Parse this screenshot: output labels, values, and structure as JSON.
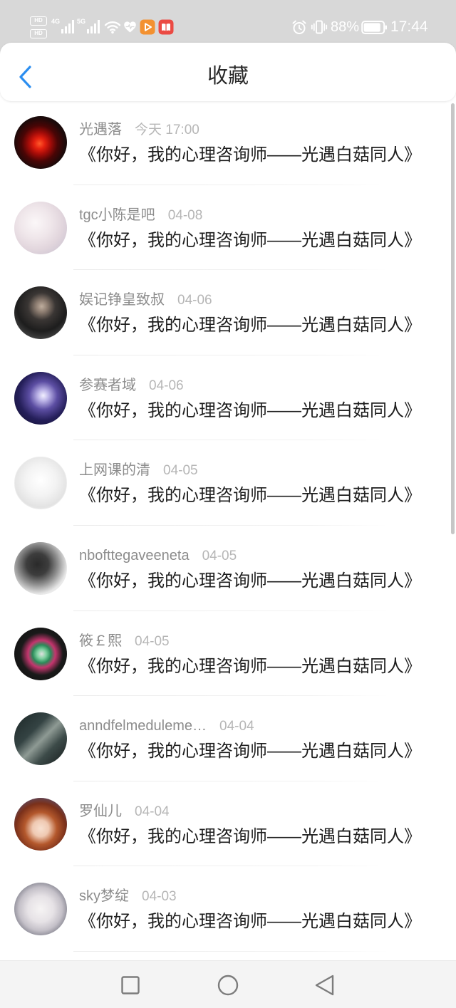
{
  "theme": {
    "accent": "#2b8ef0"
  },
  "status_bar": {
    "hd_label": "HD",
    "network_1": "4G",
    "network_2": "5G",
    "icons_left": [
      "hd-voice-badge",
      "signal-4g-icon",
      "signal-5g-icon",
      "wifi-icon",
      "heart-icon",
      "video-app-icon",
      "reader-app-icon"
    ],
    "icons_right": [
      "alarm-icon",
      "vibrate-icon",
      "battery-icon"
    ],
    "battery": {
      "level": 0.88,
      "text": "88%"
    },
    "time": "17:44"
  },
  "header": {
    "back_icon": "back-arrow-icon",
    "title": "收藏"
  },
  "favorites": {
    "items": [
      {
        "username": "光遇落",
        "date": "今天 17:00",
        "title": "《你好，我的心理咨询师——光遇白菇同人》"
      },
      {
        "username": "tgc小陈是吧",
        "date": "04-08",
        "title": "《你好，我的心理咨询师——光遇白菇同人》"
      },
      {
        "username": "娱记铮皇致叔",
        "date": "04-06",
        "title": "《你好，我的心理咨询师——光遇白菇同人》"
      },
      {
        "username": "参赛者域",
        "date": "04-06",
        "title": "《你好，我的心理咨询师——光遇白菇同人》"
      },
      {
        "username": "上网课的清",
        "date": "04-05",
        "title": "《你好，我的心理咨询师——光遇白菇同人》"
      },
      {
        "username": "nbofttegaveeneta",
        "date": "04-05",
        "title": "《你好，我的心理咨询师——光遇白菇同人》"
      },
      {
        "username": "筱￡熙",
        "date": "04-05",
        "title": "《你好，我的心理咨询师——光遇白菇同人》"
      },
      {
        "username": "anndfelmeduleme…",
        "date": "04-04",
        "title": "《你好，我的心理咨询师——光遇白菇同人》"
      },
      {
        "username": "罗仙儿",
        "date": "04-04",
        "title": "《你好，我的心理咨询师——光遇白菇同人》"
      },
      {
        "username": "sky梦绽",
        "date": "04-03",
        "title": "《你好，我的心理咨询师——光遇白菇同人》"
      }
    ]
  },
  "nav_bar": {
    "icons": [
      "recent-apps-icon",
      "home-icon",
      "back-icon"
    ]
  }
}
